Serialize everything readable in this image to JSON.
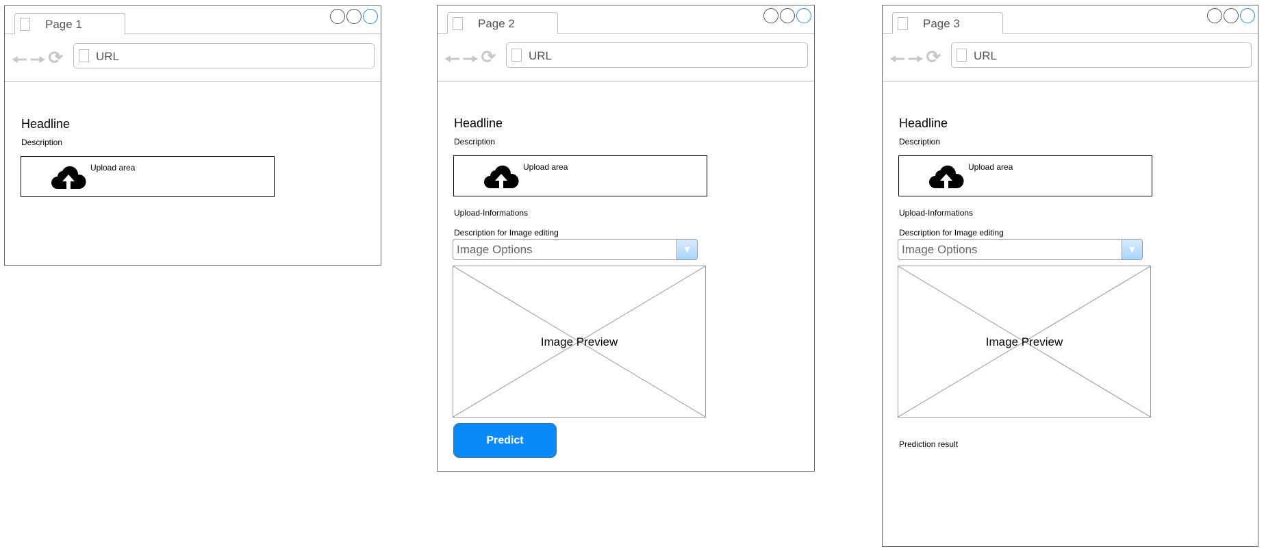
{
  "windows": [
    {
      "tab": "Page 1",
      "url": "URL",
      "headline": "Headline",
      "description": "Description",
      "upload_label": "Upload area"
    },
    {
      "tab": "Page 2",
      "url": "URL",
      "headline": "Headline",
      "description": "Description",
      "upload_label": "Upload area",
      "upload_info": "Upload-Informations",
      "edit_description": "Description for Image editing",
      "select_value": "Image Options",
      "preview_label": "Image Preview",
      "predict_label": "Predict"
    },
    {
      "tab": "Page 3",
      "url": "URL",
      "headline": "Headline",
      "description": "Description",
      "upload_label": "Upload area",
      "upload_info": "Upload-Informations",
      "edit_description": "Description for Image editing",
      "select_value": "Image Options",
      "preview_label": "Image Preview",
      "result_label": "Prediction result"
    }
  ],
  "colors": {
    "accent": "#0a8af7",
    "close": "#1a8cf0"
  }
}
